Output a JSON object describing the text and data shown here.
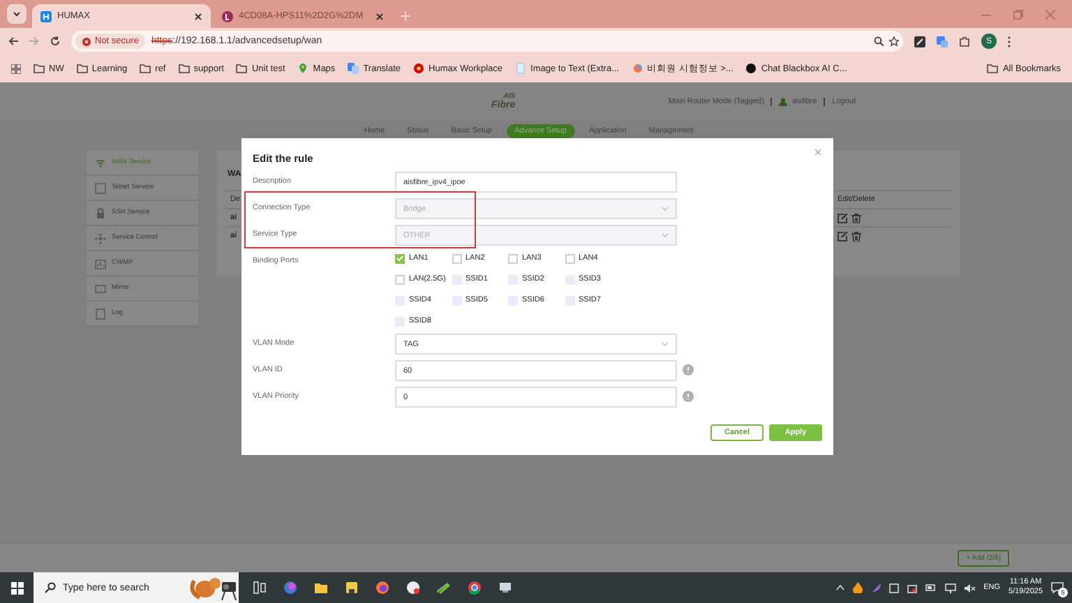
{
  "browser": {
    "tabs": [
      {
        "title": "HUMAX",
        "selected": true
      },
      {
        "title": "4CD08A-HPS11%2D2G%2DM",
        "selected": false
      }
    ],
    "security": "Not secure",
    "url_scheme": "https",
    "url_rest": "://192.168.1.1/advancedsetup/wan",
    "profile": "S",
    "bookmarks": [
      {
        "label": "NW",
        "kind": "folder"
      },
      {
        "label": "Learning",
        "kind": "folder"
      },
      {
        "label": "ref",
        "kind": "folder"
      },
      {
        "label": "support",
        "kind": "folder"
      },
      {
        "label": "Unit test",
        "kind": "folder"
      },
      {
        "label": "Maps",
        "kind": "maps"
      },
      {
        "label": "Translate",
        "kind": "translate"
      },
      {
        "label": "Humax Workplace",
        "kind": "dot"
      },
      {
        "label": "Image to Text (Extra...",
        "kind": "page"
      },
      {
        "label": "비회원 시험정보 >...",
        "kind": "swirl"
      },
      {
        "label": "Chat Blackbox AI C...",
        "kind": "dark"
      }
    ],
    "all_bookmarks": "All Bookmarks"
  },
  "router": {
    "logo_top": "AIS",
    "logo_bottom": "Fibre",
    "mode": "Main Router Mode (Tagged)",
    "user": "aisfibre",
    "logout": "Logout",
    "nav": [
      {
        "label": "Home",
        "selected": false
      },
      {
        "label": "Status",
        "selected": false
      },
      {
        "label": "Basic Setup",
        "selected": false
      },
      {
        "label": "Advance Setup",
        "selected": true
      },
      {
        "label": "Application",
        "selected": false
      },
      {
        "label": "Management",
        "selected": false
      }
    ],
    "sidebar": [
      {
        "label": "WAN Service",
        "selected": true
      },
      {
        "label": "Telnet Service",
        "selected": false
      },
      {
        "label": "SSH Service",
        "selected": false
      },
      {
        "label": "Service Control",
        "selected": false
      },
      {
        "label": "CWMP",
        "selected": false
      },
      {
        "label": "Mirror",
        "selected": false
      },
      {
        "label": "Log",
        "selected": false
      }
    ],
    "card_title": "WA",
    "column_1": "De",
    "column_actions": "Edit/Delete",
    "rows": [
      "ai",
      "ai"
    ],
    "add_button": "+ Add (2/6)"
  },
  "dialog": {
    "title": "Edit the rule",
    "fields": [
      {
        "label": "Description",
        "kind": "text",
        "value": "aisfibre_ipv4_ipoe",
        "disabled": false
      },
      {
        "label": "Connection Type",
        "kind": "select",
        "value": "Bridge",
        "disabled": true
      },
      {
        "label": "Service Type",
        "kind": "select",
        "value": "OTHER",
        "disabled": true
      },
      {
        "label": "Binding Ports",
        "kind": "checkboxes",
        "ports": [
          {
            "label": "LAN1",
            "checked": true,
            "disabled": false
          },
          {
            "label": "LAN2",
            "checked": false,
            "disabled": false
          },
          {
            "label": "LAN3",
            "checked": false,
            "disabled": false
          },
          {
            "label": "LAN4",
            "checked": false,
            "disabled": false
          },
          {
            "label": "LAN(2.5G)",
            "checked": false,
            "disabled": false
          },
          {
            "label": "SSID1",
            "checked": false,
            "disabled": true
          },
          {
            "label": "SSID2",
            "checked": false,
            "disabled": true
          },
          {
            "label": "SSID3",
            "checked": false,
            "disabled": true
          },
          {
            "label": "SSID4",
            "checked": false,
            "disabled": true
          },
          {
            "label": "SSID5",
            "checked": false,
            "disabled": true
          },
          {
            "label": "SSID6",
            "checked": false,
            "disabled": true
          },
          {
            "label": "SSID7",
            "checked": false,
            "disabled": true
          },
          {
            "label": "SSID8",
            "checked": false,
            "disabled": true
          }
        ]
      },
      {
        "label": "VLAN Mode",
        "kind": "select",
        "value": "TAG",
        "disabled": false
      },
      {
        "label": "VLAN ID",
        "kind": "text",
        "value": "60",
        "disabled": false,
        "info": true
      },
      {
        "label": "VLAN Priority",
        "kind": "text",
        "value": "0",
        "disabled": false,
        "info": true
      }
    ],
    "cancel": "Cancel",
    "apply": "Apply"
  },
  "taskbar": {
    "search_placeholder": "Type here to search",
    "language": "ENG",
    "time": "11:16 AM",
    "date": "5/19/2025",
    "notifications": "5"
  }
}
